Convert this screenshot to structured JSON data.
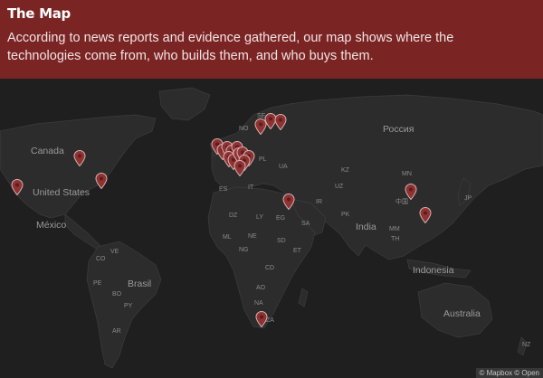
{
  "header": {
    "title": "The Map",
    "description": "According to news reports and evidence gathered, our map shows where the technologies come from, who builds them, and who buys them."
  },
  "map": {
    "labels": {
      "canada": "Canada",
      "united_states": "United States",
      "mexico": "México",
      "brasil": "Brasil",
      "russia": "Россия",
      "india": "India",
      "indonesia": "Indonesia",
      "australia": "Australia",
      "kz": "KZ",
      "mn": "MN",
      "jp": "JP",
      "ir": "IR",
      "pk": "PK",
      "sa": "SA",
      "eg": "EG",
      "ly": "LY",
      "dz": "DZ",
      "ml": "ML",
      "ne": "NE",
      "ng": "NG",
      "sd": "SD",
      "et": "ET",
      "cd": "CD",
      "ao": "AO",
      "na": "NA",
      "za": "ZA",
      "es": "ES",
      "it": "IT",
      "pl": "PL",
      "ua": "UA",
      "no": "NO",
      "se": "SE",
      "uz": "UZ",
      "mm": "MM",
      "th": "TH",
      "co": "CO",
      "ve": "VE",
      "pe": "PE",
      "bo": "BO",
      "py": "PY",
      "ar": "AR",
      "nz": "NZ",
      "cn": "中国"
    },
    "attribution": "© Mapbox © Open",
    "marker_color": "#8e3232"
  }
}
